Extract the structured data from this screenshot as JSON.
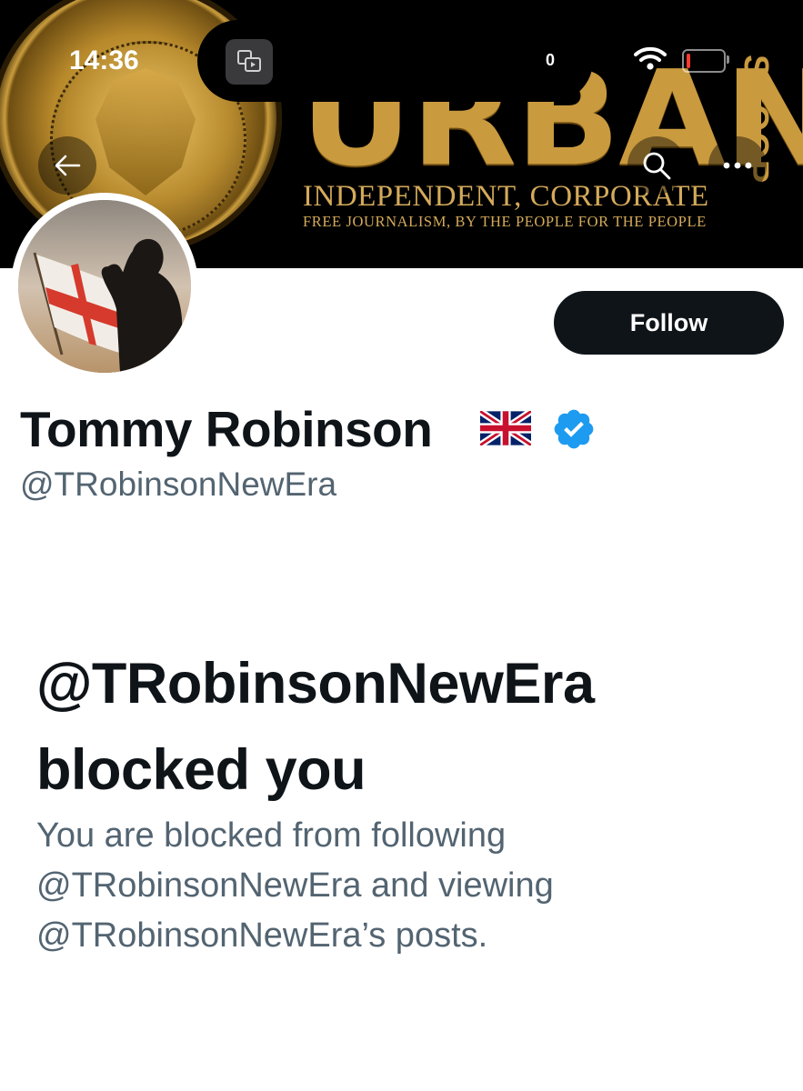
{
  "status_bar": {
    "time": "14:36",
    "island_count": "0"
  },
  "banner": {
    "brand_word": "URBAN",
    "brand_side_word": "SCOOP",
    "tagline_main": "INDEPENDENT, CORPORATE",
    "tagline_sub": "FREE JOURNALISM, BY THE PEOPLE FOR THE PEOPLE"
  },
  "nav": {
    "back_icon": "back-arrow-icon",
    "search_icon": "search-icon",
    "more_icon": "more-options-icon"
  },
  "profile": {
    "display_name": "Tommy Robinson",
    "name_emoji": "uk-flag-emoji",
    "verified_badge_color": "#1d9bf0",
    "handle": "@TRobinsonNewEra",
    "follow_label": "Follow"
  },
  "blocked": {
    "title_line1": "@TRobinsonNewEra",
    "title_line2": "blocked you",
    "desc_line1": "You are blocked from following",
    "desc_line2": "@TRobinsonNewEra and viewing",
    "desc_line3": "@TRobinsonNewEra’s posts."
  },
  "colors": {
    "primary_text": "#0f1419",
    "secondary_text": "#536471",
    "follow_bg": "#0f1419",
    "gold": "#c99a3e"
  }
}
